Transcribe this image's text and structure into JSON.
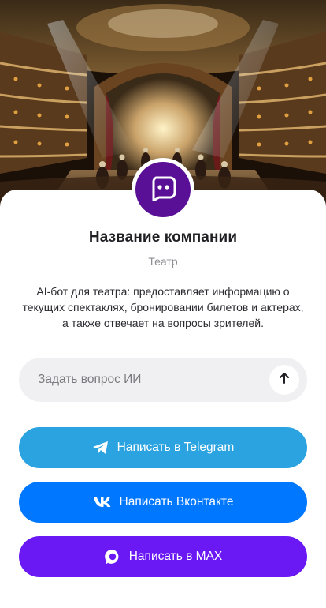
{
  "hero": {
    "image": "theater-stage-illustration"
  },
  "profile": {
    "avatar_icon": "chat-bot-face-icon",
    "name": "Название компании",
    "category": "Театр",
    "description": "AI-бот для театра: предоставляет информацию о текущих спектаклях, бронировании билетов и актерах, а также отвечает на вопросы зрителей."
  },
  "ask": {
    "placeholder": "Задать вопрос ИИ",
    "send_icon": "arrow-up-icon"
  },
  "buttons": {
    "telegram": {
      "label": "Написать в Telegram",
      "icon": "telegram-icon",
      "color": "#2aa3e0"
    },
    "vk": {
      "label": "Написать Вконтакте",
      "icon": "vk-icon",
      "color": "#0077ff"
    },
    "max": {
      "label": "Написать в MAX",
      "icon": "max-icon",
      "color": "#6a19f5"
    }
  },
  "colors": {
    "avatar_bg": "#5a1096",
    "input_bg": "#f0f0f2"
  }
}
